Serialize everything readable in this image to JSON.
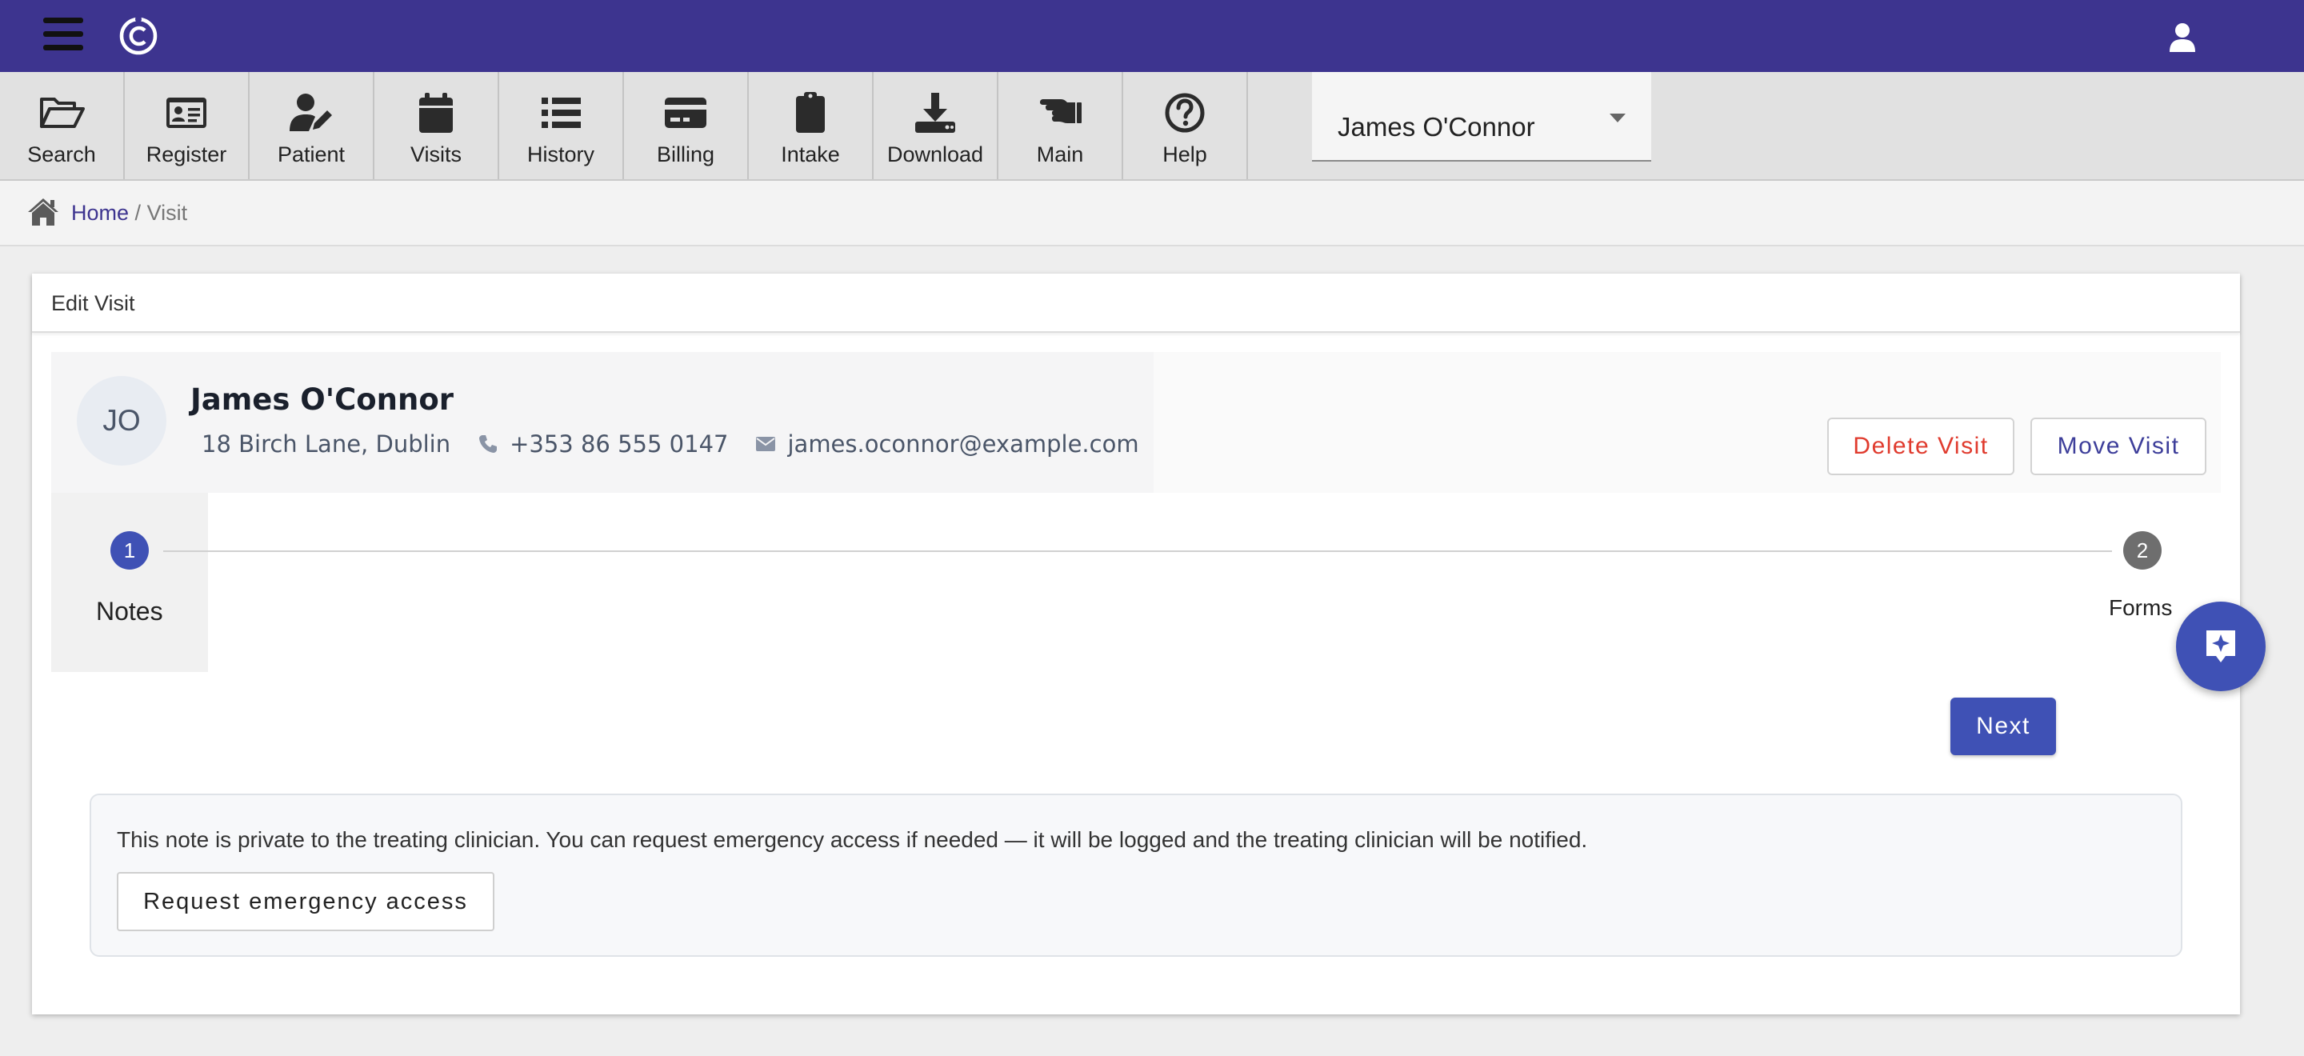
{
  "toolbar": {
    "items": [
      {
        "label": "Search",
        "icon": "folder-open-icon"
      },
      {
        "label": "Register",
        "icon": "id-card-icon"
      },
      {
        "label": "Patient",
        "icon": "user-edit-icon"
      },
      {
        "label": "Visits",
        "icon": "calendar-icon"
      },
      {
        "label": "History",
        "icon": "list-icon"
      },
      {
        "label": "Billing",
        "icon": "credit-card-icon"
      },
      {
        "label": "Intake",
        "icon": "clipboard-icon"
      },
      {
        "label": "Download",
        "icon": "download-icon"
      },
      {
        "label": "Main",
        "icon": "hand-point-left-icon"
      },
      {
        "label": "Help",
        "icon": "question-circle-icon"
      }
    ],
    "patient_select": "James O'Connor"
  },
  "breadcrumb": {
    "home": "Home",
    "separator": "/",
    "current": "Visit"
  },
  "card": {
    "title": "Edit Visit"
  },
  "patient": {
    "initials": "JO",
    "name": "James O'Connor",
    "address": "18 Birch Lane, Dublin",
    "phone": "+353 86 555 0147",
    "email": "james.oconnor@example.com"
  },
  "actions": {
    "delete": "Delete Visit",
    "move": "Move Visit",
    "next": "Next"
  },
  "stepper": {
    "steps": [
      {
        "number": "1",
        "label": "Notes",
        "active": true
      },
      {
        "number": "2",
        "label": "Forms",
        "active": false
      }
    ]
  },
  "note": {
    "text": "This note is private to the treating clinician. You can request emergency access if needed — it will be logged and the treating clinician will be notified.",
    "button": "Request emergency access"
  },
  "colors": {
    "header": "#3d348f",
    "primary": "#3f51b5",
    "danger": "#e03b2e"
  }
}
